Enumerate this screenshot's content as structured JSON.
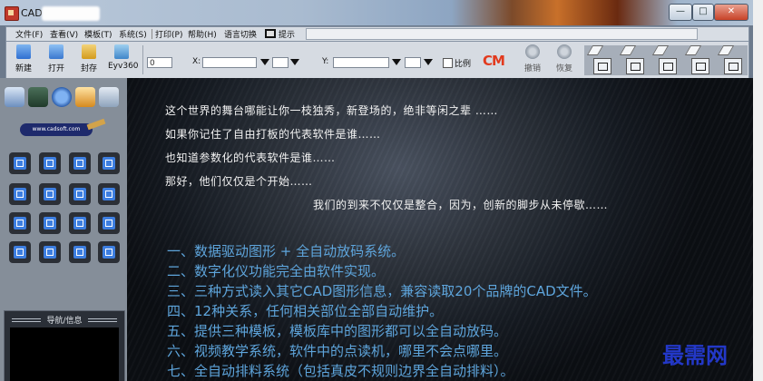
{
  "window": {
    "title": "CAD -"
  },
  "controls": {
    "minimize": "—",
    "maximize": "□",
    "close": "✕"
  },
  "menu": {
    "items": [
      "文件(F)",
      "查看(V)",
      "模板(T)",
      "系统(S)",
      "打印(P)",
      "帮助(H)",
      "语言切换"
    ],
    "extra": "提示"
  },
  "toolbar": {
    "new": "新建",
    "open": "打开",
    "save": "封存",
    "eyv": "Eyv360",
    "undo": "撤销",
    "redo": "恢复",
    "input_value": "0",
    "x_label": "X:",
    "y_label": "Y:",
    "ratio_label": "比例",
    "cm_logo": "CM"
  },
  "left_panel": {
    "brand_text": "www.cadsoft.com",
    "nav_title": "导航/信息"
  },
  "canvas": {
    "intro_lines": [
      "这个世界的舞台哪能让你一枝独秀，新登场的，绝非等闲之辈 ……",
      "如果你记住了自由打板的代表软件是谁……",
      "也知道参数化的代表软件是谁……",
      "那好，他们仅仅是个开始……",
      "我们的到来不仅仅是整合，因为，创新的脚步从未停歇……"
    ],
    "features": [
      "一、数据驱动图形 + 全自动放码系统。",
      "二、数字化仪功能完全由软件实现。",
      "三、三种方式读入其它CAD图形信息，兼容读取20个品牌的CAD文件。",
      "四、12种关系，任何相关部位全部自动维护。",
      "五、提供三种模板，模板库中的图形都可以全自动放码。",
      "六、视频教学系统，软件中的点读机，哪里不会点哪里。",
      "七、全自动排料系统（包括真皮不规则边界全自动排料）。"
    ]
  },
  "watermark": "最需网",
  "colors": {
    "feature_text": "#5ea5dc",
    "intro_text": "#f2f2f2",
    "cm_logo": "#e23a1e",
    "watermark": "#2338c8"
  },
  "icons": {
    "left_top": [
      "pen-icon",
      "layers-icon",
      "circle-icon",
      "cone-icon",
      "print-icon"
    ],
    "grid": [
      "panel-icon",
      "flip-icon",
      "pattern-icon",
      "measure-icon",
      "text-icon",
      "move-icon",
      "w-icon",
      "cross-icon",
      "frame-icon",
      "curve-icon",
      "film-icon",
      "edit-icon",
      "square-icon",
      "star-icon",
      "grid-icon",
      "tag-icon"
    ]
  }
}
